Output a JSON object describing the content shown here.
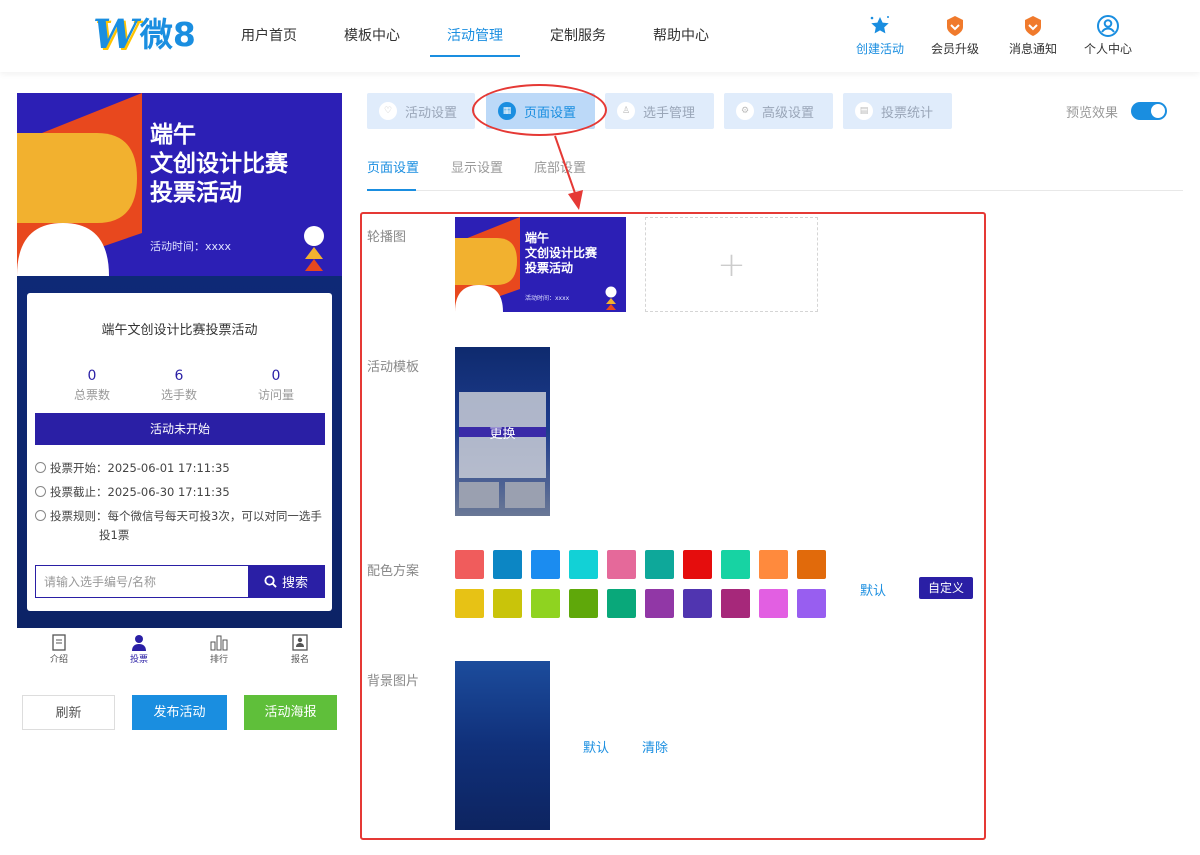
{
  "logo": {
    "mark": "W",
    "text": "微8"
  },
  "nav": {
    "items": [
      "用户首页",
      "模板中心",
      "活动管理",
      "定制服务",
      "帮助中心"
    ],
    "active_index": 2,
    "tools": [
      {
        "label": "创建活动",
        "icon": "star-icon"
      },
      {
        "label": "会员升级",
        "icon": "member-badge-icon"
      },
      {
        "label": "消息通知",
        "icon": "notification-badge-icon"
      },
      {
        "label": "个人中心",
        "icon": "user-circle-icon"
      }
    ]
  },
  "preview": {
    "banner": {
      "title_line1": "端午",
      "title_line2": "文创设计比赛",
      "title_line3": "投票活动",
      "time": "活动时间：xxxx"
    },
    "card_title": "端午文创设计比赛投票活动",
    "stats": [
      {
        "value": "0",
        "label": "总票数"
      },
      {
        "value": "6",
        "label": "选手数"
      },
      {
        "value": "0",
        "label": "访问量"
      }
    ],
    "status_button": "活动未开始",
    "vote_start": "投票开始：2025-06-01 17:11:35",
    "vote_end": "投票截止：2025-06-30 17:11:35",
    "vote_rule_line1": "投票规则：每个微信号每天可投3次，可以对同一选手",
    "vote_rule_line2": "投1票",
    "search_placeholder": "请输入选手编号/名称",
    "search_button": "搜索",
    "tabs": [
      "介绍",
      "投票",
      "排行",
      "报名"
    ]
  },
  "actions": {
    "refresh": "刷新",
    "publish": "发布活动",
    "poster": "活动海报"
  },
  "settings_tabs": [
    "活动设置",
    "页面设置",
    "选手管理",
    "高级设置",
    "投票统计"
  ],
  "preview_toggle": {
    "label": "预览效果",
    "on": true
  },
  "sub_tabs": [
    "页面设置",
    "显示设置",
    "底部设置"
  ],
  "form": {
    "carousel_label": "轮播图",
    "carousel": {
      "title_line1": "端午",
      "title_line2": "文创设计比赛",
      "title_line3": "投票活动",
      "time": "活动时间：xxxx"
    },
    "add_symbol": "+",
    "template_label": "活动模板",
    "template_change": "更换",
    "color_label": "配色方案",
    "colors_row1": [
      "#f05c5c",
      "#0c86c4",
      "#1b8cf0",
      "#12d1d6",
      "#e5699a",
      "#0ea89a",
      "#e50d0d",
      "#17d3a3",
      "#ff8a3d",
      "#e16a0b"
    ],
    "colors_row2": [
      "#e7c215",
      "#c9c40a",
      "#8fd320",
      "#5fa80a",
      "#09a87a",
      "#9137a6",
      "#5035b0",
      "#a6287a",
      "#e25fe2",
      "#985ef0"
    ],
    "color_default": "默认",
    "color_custom": "自定义",
    "bg_label": "背景图片",
    "bg_default": "默认",
    "bg_clear": "清除"
  }
}
